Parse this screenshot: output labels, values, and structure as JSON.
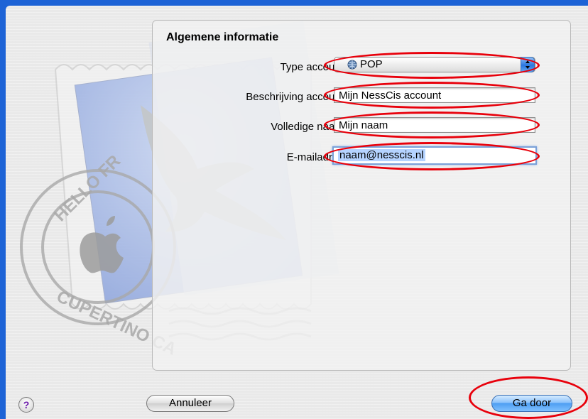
{
  "panel": {
    "title": "Algemene informatie"
  },
  "form": {
    "account_type": {
      "label": "Type account:",
      "value": "POP",
      "icon": "globe-icon"
    },
    "account_description": {
      "label": "Beschrijving account:",
      "value": "Mijn NessCis account"
    },
    "full_name": {
      "label": "Volledige naam:",
      "value": "Mijn naam"
    },
    "email": {
      "label": "E-mailadres:",
      "value": "naam@nesscis.nl"
    }
  },
  "stamp": {
    "text_top": "HELLO FR",
    "text_bottom": "CUPERTINO CA"
  },
  "buttons": {
    "help": "?",
    "cancel": "Annuleer",
    "continue": "Ga door"
  },
  "colors": {
    "desktop_blue": "#1d63d6",
    "annotation_red": "#e8000b",
    "focus_ring": "#7ba1d8"
  }
}
